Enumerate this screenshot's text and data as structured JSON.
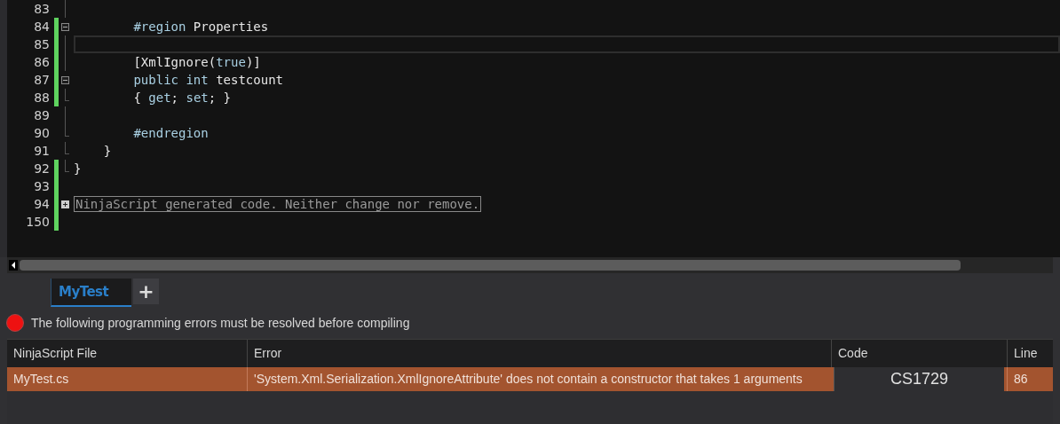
{
  "editor": {
    "lines": [
      {
        "number": "83",
        "changed": false,
        "fold": {
          "kind": "line"
        },
        "current": false
      },
      {
        "number": "84",
        "changed": true,
        "fold": {
          "kind": "minus"
        },
        "current": false,
        "segments": [
          {
            "text": "        #region",
            "kind": "keyword"
          },
          {
            "text": " Properties",
            "kind": "plain"
          }
        ]
      },
      {
        "number": "85",
        "changed": true,
        "fold": {
          "kind": "line"
        },
        "current": true
      },
      {
        "number": "86",
        "changed": true,
        "fold": {
          "kind": "line"
        },
        "current": false,
        "segments": [
          {
            "text": "        [XmlIgnore(",
            "kind": "plain"
          },
          {
            "text": "true",
            "kind": "keyword"
          },
          {
            "text": ")]",
            "kind": "plain"
          }
        ]
      },
      {
        "number": "87",
        "changed": true,
        "fold": {
          "kind": "minus"
        },
        "current": false,
        "segments": [
          {
            "text": "        public int",
            "kind": "keyword"
          },
          {
            "text": " testcount",
            "kind": "plain"
          }
        ]
      },
      {
        "number": "88",
        "changed": true,
        "fold": {
          "kind": "end"
        },
        "current": false,
        "segments": [
          {
            "text": "        { ",
            "kind": "plain"
          },
          {
            "text": "get",
            "kind": "keyword"
          },
          {
            "text": "; ",
            "kind": "plain"
          },
          {
            "text": "set",
            "kind": "keyword"
          },
          {
            "text": "; }",
            "kind": "plain"
          }
        ]
      },
      {
        "number": "89",
        "changed": false,
        "fold": {
          "kind": "line"
        },
        "current": false
      },
      {
        "number": "90",
        "changed": false,
        "fold": {
          "kind": "end"
        },
        "current": false,
        "segments": [
          {
            "text": "        #endregion",
            "kind": "keyword"
          }
        ]
      },
      {
        "number": "91",
        "changed": false,
        "fold": {
          "kind": "end"
        },
        "current": false,
        "segments": [
          {
            "text": "    }",
            "kind": "plain"
          }
        ]
      },
      {
        "number": "92",
        "changed": true,
        "fold": {
          "kind": "end"
        },
        "current": false,
        "segments": [
          {
            "text": "}",
            "kind": "plain"
          }
        ]
      },
      {
        "number": "93",
        "changed": true,
        "current": false
      },
      {
        "number": "94",
        "changed": true,
        "fold": {
          "kind": "plus"
        },
        "current": false,
        "segments": [
          {
            "text": "NinjaScript generated code. Neither change nor remove.",
            "kind": "collapsed"
          }
        ]
      },
      {
        "number": "150",
        "changed": true,
        "current": false
      }
    ]
  },
  "tabs": [
    {
      "label": "MyTest",
      "selected": true
    }
  ],
  "add_tab": "+",
  "message": "The following programming errors must be resolved before compiling",
  "table": {
    "columns": [
      "NinjaScript File",
      "Error",
      "Code",
      "Line"
    ],
    "rows": [
      {
        "selected": true,
        "cells": [
          "MyTest.cs",
          "'System.Xml.Serialization.XmlIgnoreAttribute' does not contain a constructor that takes 1 arguments",
          "CS1729",
          "86"
        ]
      }
    ]
  }
}
